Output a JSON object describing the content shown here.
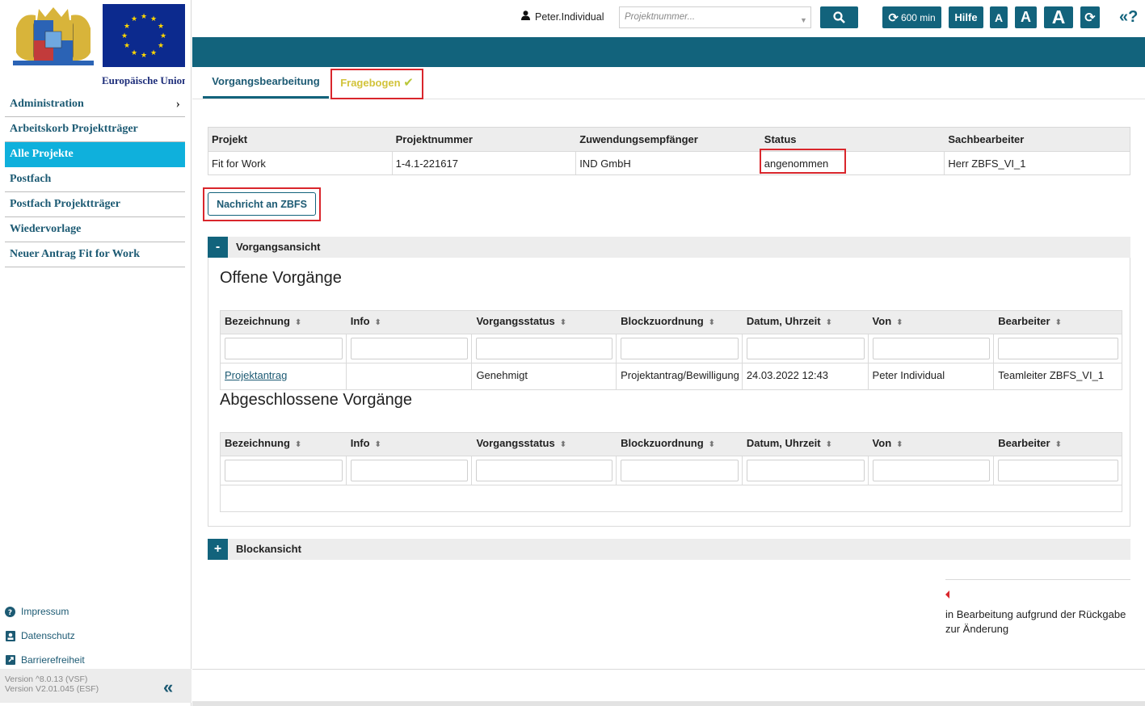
{
  "sidebar": {
    "eu_caption": "Europäische Union",
    "nav": [
      {
        "label": "Administration"
      },
      {
        "label": "Arbeitskorb Projektträger"
      },
      {
        "label": "Alle Projekte"
      },
      {
        "label": "Postfach"
      },
      {
        "label": "Postfach Projektträger"
      },
      {
        "label": "Wiedervorlage"
      },
      {
        "label": "Neuer Antrag Fit for Work"
      }
    ],
    "footer": {
      "impressum": "Impressum",
      "datenschutz": "Datenschutz",
      "barrierefreiheit": "Barrierefreiheit"
    },
    "version_vsf": "Version ^8.0.13 (VSF)",
    "version_esf": "Version V2.01.045 (ESF)"
  },
  "topbar": {
    "user": "Peter.Individual",
    "search_placeholder": "Projektnummer...",
    "session_timer": "600 min",
    "help": "Hilfe",
    "font_small": "A",
    "font_medium": "A",
    "font_large": "A",
    "help_icon": "«?"
  },
  "tabs": {
    "vorgang": "Vorgangsbearbeitung",
    "fragebogen": "Fragebogen"
  },
  "project_table": {
    "headers": [
      "Projekt",
      "Projektnummer",
      "Zuwendungsempfänger",
      "Status",
      "Sachbearbeiter"
    ],
    "row": [
      "Fit for Work",
      "1-4.1-221617",
      "IND GmbH",
      "angenommen",
      "Herr ZBFS_VI_1"
    ]
  },
  "message_button": "Nachricht an ZBFS",
  "accordions": {
    "vorgangsansicht": "Vorgangsansicht",
    "vorgangsansicht_toggle": "-",
    "blockansicht": "Blockansicht",
    "blockansicht_toggle": "+"
  },
  "offene": {
    "title": "Offene Vorgänge",
    "headers": [
      "Bezeichnung",
      "Info",
      "Vorgangsstatus",
      "Blockzuordnung",
      "Datum, Uhrzeit",
      "Von",
      "Bearbeiter"
    ],
    "rows": [
      [
        "Projektantrag",
        "",
        "Genehmigt",
        "Projektantrag/Bewilligung",
        "24.03.2022 12:43",
        "Peter Individual",
        "Teamleiter ZBFS_VI_1"
      ]
    ]
  },
  "abgeschlossene": {
    "title": "Abgeschlossene Vorgänge",
    "headers": [
      "Bezeichnung",
      "Info",
      "Vorgangsstatus",
      "Blockzuordnung",
      "Datum, Uhrzeit",
      "Von",
      "Bearbeiter"
    ]
  },
  "legend_text": "in Bearbeitung aufgrund der Rückgabe zur Änderung",
  "colors": {
    "primary": "#12637c",
    "active_nav": "#0fb0dc",
    "highlight": "#d9262c",
    "fragebogen_text": "#d2c33a"
  }
}
